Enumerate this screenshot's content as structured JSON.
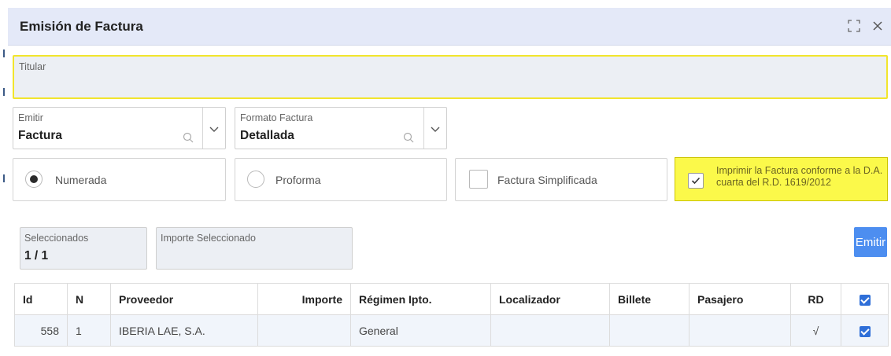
{
  "dialog": {
    "title": "Emisión de Factura"
  },
  "titular": {
    "label": "Titular",
    "value": ""
  },
  "emitir": {
    "label": "Emitir",
    "value": "Factura"
  },
  "formato": {
    "label": "Formato Factura",
    "value": "Detallada"
  },
  "options": {
    "numerada": {
      "label": "Numerada",
      "selected": true
    },
    "proforma": {
      "label": "Proforma",
      "selected": false
    },
    "simplificada": {
      "label": "Factura Simplificada",
      "checked": false
    },
    "imprimir": {
      "label": "Imprimir la Factura conforme a la D.A. cuarta del R.D. 1619/2012",
      "checked": true
    }
  },
  "stats": {
    "seleccionados_label": "Seleccionados",
    "seleccionados_value": "1 / 1",
    "importe_label": "Importe Seleccionado",
    "importe_value": ""
  },
  "emit_button": "Emitir",
  "table": {
    "headers": [
      "Id",
      "N",
      "Proveedor",
      "Importe",
      "Régimen Ipto.",
      "Localizador",
      "Billete",
      "Pasajero",
      "RD"
    ],
    "rows": [
      {
        "id": "558",
        "n": "1",
        "proveedor": "IBERIA LAE, S.A.",
        "importe": "",
        "regimen": "General",
        "localizador": "",
        "billete": "",
        "pasajero": "",
        "rd": "√",
        "checked": true
      }
    ],
    "header_checked": true
  },
  "colors": {
    "header_bg": "#e4e9f8",
    "highlight_yellow": "#fbf94a",
    "accent_blue": "#4d8ef0",
    "checkbox_blue": "#2f6fd8"
  },
  "icons": [
    "maximize-icon",
    "close-icon",
    "search-icon",
    "chevron-down-icon",
    "check-icon"
  ]
}
